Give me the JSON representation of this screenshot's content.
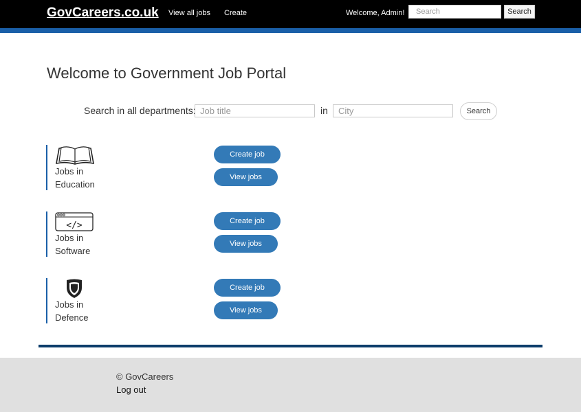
{
  "navbar": {
    "brand": "GovCareers.co.uk",
    "links": [
      {
        "label": "View all jobs"
      },
      {
        "label": "Create"
      }
    ],
    "welcome": "Welcome, Admin!",
    "search_placeholder": "Search",
    "search_button": "Search",
    "background_color": "#000000",
    "stripe_color": "#1a5fa8"
  },
  "main": {
    "title": "Welcome to Government Job Portal",
    "search": {
      "label": "Search in all departments:",
      "job_placeholder": "Job title",
      "in_label": "in",
      "city_placeholder": "City",
      "button": "Search"
    },
    "departments": [
      {
        "icon": "book-icon",
        "line1": "Jobs in",
        "line2": "Education",
        "create_label": "Create job",
        "view_label": "View jobs"
      },
      {
        "icon": "code-window-icon",
        "line1": "Jobs in",
        "line2": "Software",
        "create_label": "Create job",
        "view_label": "View jobs"
      },
      {
        "icon": "shield-icon",
        "line1": "Jobs in",
        "line2": "Defence",
        "create_label": "Create job",
        "view_label": "View jobs"
      }
    ],
    "button_color": "#337ab7"
  },
  "footer": {
    "copyright": "© GovCareers",
    "logout": "Log out",
    "background_color": "#e0e0e0"
  }
}
